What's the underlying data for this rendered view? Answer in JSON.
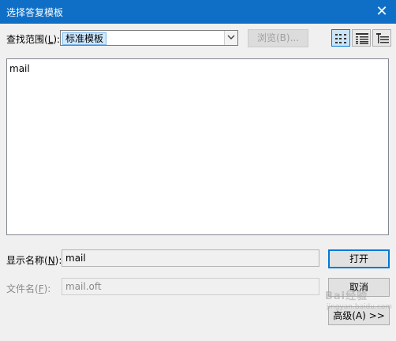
{
  "window": {
    "title": "选择答复模板",
    "close_glyph": "✕"
  },
  "look_in": {
    "label_prefix": "查找范围(",
    "label_key": "L",
    "label_suffix": "):",
    "selected": "标准模板"
  },
  "toolbar": {
    "browse_label": "浏览(B)..."
  },
  "view_buttons": [
    "list-view-icon",
    "details-view-icon",
    "properties-view-icon"
  ],
  "file_list": {
    "items": [
      "mail"
    ]
  },
  "display_name": {
    "label_prefix": "显示名称(",
    "label_key": "N",
    "label_suffix": "):",
    "value": "mail"
  },
  "file_name": {
    "label_prefix": "文件名(",
    "label_key": "F",
    "label_suffix": "):",
    "value": "mail.oft"
  },
  "buttons": {
    "open": "打开",
    "cancel": "取消",
    "advanced": "高级(A) >>"
  },
  "watermark": {
    "text": "Bai经验",
    "subtext": "jingyan.baidu.com"
  },
  "colors": {
    "titlebar": "#0f6fc6",
    "selection": "#cde8ff",
    "focus_border": "#0078d7"
  }
}
